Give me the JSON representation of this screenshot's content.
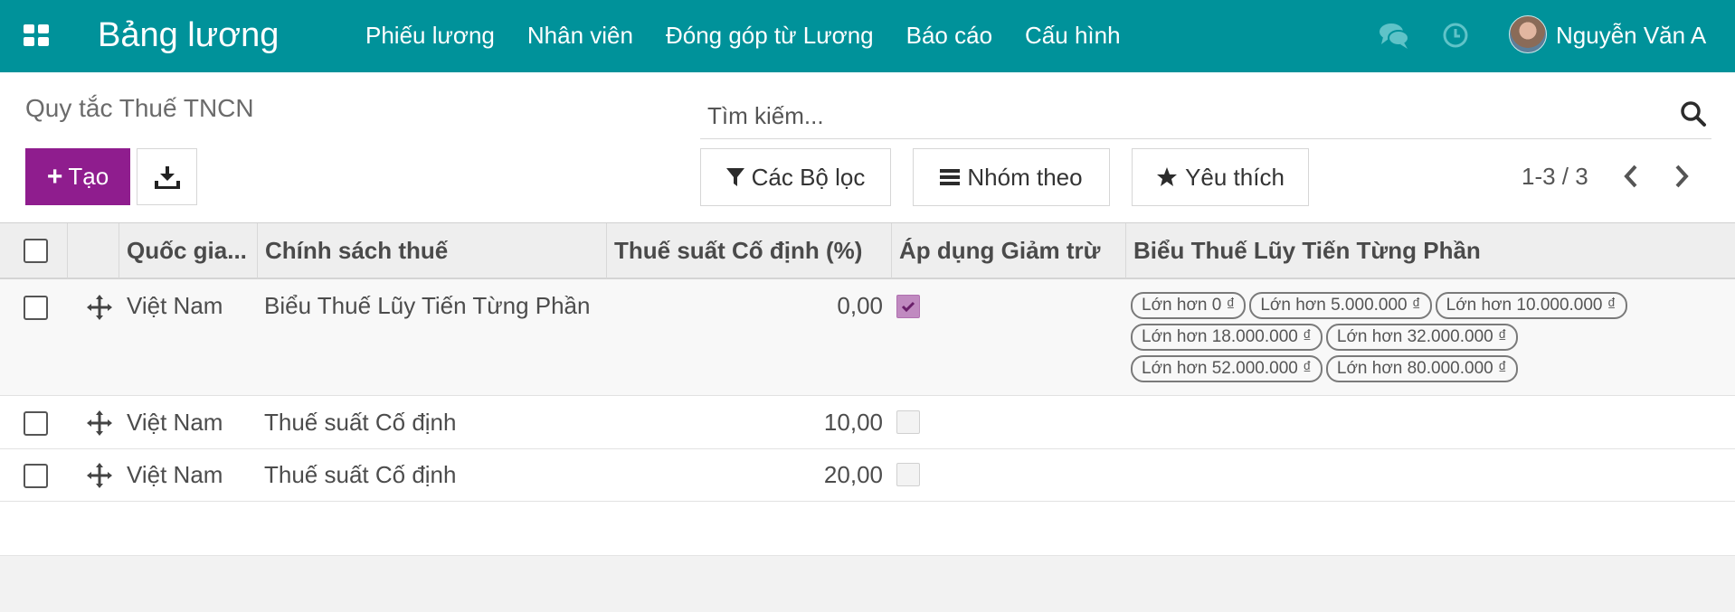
{
  "navbar": {
    "app_title": "Bảng lương",
    "menu": [
      "Phiếu lương",
      "Nhân viên",
      "Đóng góp từ Lương",
      "Báo cáo",
      "Cấu hình"
    ],
    "user_name": "Nguyễn Văn A",
    "color": "#00929a"
  },
  "control": {
    "page_title": "Quy tắc Thuế TNCN",
    "search_placeholder": "Tìm kiếm...",
    "create_label": "Tạo",
    "filters_label": "Các Bộ lọc",
    "group_by_label": "Nhóm theo",
    "favorites_label": "Yêu thích",
    "pager": "1-3 / 3",
    "create_color": "#8f1d8e"
  },
  "table": {
    "headers": [
      "Quốc gia...",
      "Chính sách thuế",
      "Thuế suất Cố định (%)",
      "Áp dụng Giảm trừ",
      "Biểu Thuế Lũy Tiến Từng Phần"
    ],
    "rows": [
      {
        "country": "Việt Nam",
        "policy": "Biểu Thuế Lũy Tiến Từng Phần",
        "rate": "0,00",
        "deduction": true,
        "brackets": [
          "Lớn hơn 0 ₫",
          "Lớn hơn 5.000.000 ₫",
          "Lớn hơn 10.000.000 ₫",
          "Lớn hơn 18.000.000 ₫",
          "Lớn hơn 32.000.000 ₫",
          "Lớn hơn 52.000.000 ₫",
          "Lớn hơn 80.000.000 ₫"
        ]
      },
      {
        "country": "Việt Nam",
        "policy": "Thuế suất Cố định",
        "rate": "10,00",
        "deduction": false,
        "brackets": []
      },
      {
        "country": "Việt Nam",
        "policy": "Thuế suất Cố định",
        "rate": "20,00",
        "deduction": false,
        "brackets": []
      }
    ]
  }
}
